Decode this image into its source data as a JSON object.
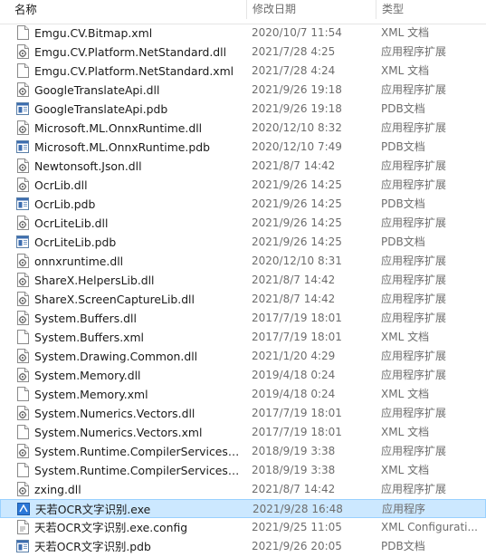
{
  "columns": {
    "name": "名称",
    "date": "修改日期",
    "type": "类型"
  },
  "files": [
    {
      "name": "Emgu.CV.Bitmap.xml",
      "date": "2020/10/7 11:54",
      "type": "XML 文档",
      "icon": "xml-icon"
    },
    {
      "name": "Emgu.CV.Platform.NetStandard.dll",
      "date": "2021/7/28 4:25",
      "type": "应用程序扩展",
      "icon": "dll-icon"
    },
    {
      "name": "Emgu.CV.Platform.NetStandard.xml",
      "date": "2021/7/28 4:24",
      "type": "XML 文档",
      "icon": "xml-icon"
    },
    {
      "name": "GoogleTranslateApi.dll",
      "date": "2021/9/26 19:18",
      "type": "应用程序扩展",
      "icon": "dll-icon"
    },
    {
      "name": "GoogleTranslateApi.pdb",
      "date": "2021/9/26 19:18",
      "type": "PDB文档",
      "icon": "pdb-icon"
    },
    {
      "name": "Microsoft.ML.OnnxRuntime.dll",
      "date": "2020/12/10 8:32",
      "type": "应用程序扩展",
      "icon": "dll-icon"
    },
    {
      "name": "Microsoft.ML.OnnxRuntime.pdb",
      "date": "2020/12/10 7:49",
      "type": "PDB文档",
      "icon": "pdb-icon"
    },
    {
      "name": "Newtonsoft.Json.dll",
      "date": "2021/8/7 14:42",
      "type": "应用程序扩展",
      "icon": "dll-icon"
    },
    {
      "name": "OcrLib.dll",
      "date": "2021/9/26 14:25",
      "type": "应用程序扩展",
      "icon": "dll-icon"
    },
    {
      "name": "OcrLib.pdb",
      "date": "2021/9/26 14:25",
      "type": "PDB文档",
      "icon": "pdb-icon"
    },
    {
      "name": "OcrLiteLib.dll",
      "date": "2021/9/26 14:25",
      "type": "应用程序扩展",
      "icon": "dll-icon"
    },
    {
      "name": "OcrLiteLib.pdb",
      "date": "2021/9/26 14:25",
      "type": "PDB文档",
      "icon": "pdb-icon"
    },
    {
      "name": "onnxruntime.dll",
      "date": "2020/12/10 8:31",
      "type": "应用程序扩展",
      "icon": "dll-icon"
    },
    {
      "name": "ShareX.HelpersLib.dll",
      "date": "2021/8/7 14:42",
      "type": "应用程序扩展",
      "icon": "dll-icon"
    },
    {
      "name": "ShareX.ScreenCaptureLib.dll",
      "date": "2021/8/7 14:42",
      "type": "应用程序扩展",
      "icon": "dll-icon"
    },
    {
      "name": "System.Buffers.dll",
      "date": "2017/7/19 18:01",
      "type": "应用程序扩展",
      "icon": "dll-icon"
    },
    {
      "name": "System.Buffers.xml",
      "date": "2017/7/19 18:01",
      "type": "XML 文档",
      "icon": "xml-icon"
    },
    {
      "name": "System.Drawing.Common.dll",
      "date": "2021/1/20 4:29",
      "type": "应用程序扩展",
      "icon": "dll-icon"
    },
    {
      "name": "System.Memory.dll",
      "date": "2019/4/18 0:24",
      "type": "应用程序扩展",
      "icon": "dll-icon"
    },
    {
      "name": "System.Memory.xml",
      "date": "2019/4/18 0:24",
      "type": "XML 文档",
      "icon": "xml-icon"
    },
    {
      "name": "System.Numerics.Vectors.dll",
      "date": "2017/7/19 18:01",
      "type": "应用程序扩展",
      "icon": "dll-icon"
    },
    {
      "name": "System.Numerics.Vectors.xml",
      "date": "2017/7/19 18:01",
      "type": "XML 文档",
      "icon": "xml-icon"
    },
    {
      "name": "System.Runtime.CompilerServices.Un...",
      "date": "2018/9/19 3:38",
      "type": "应用程序扩展",
      "icon": "dll-icon"
    },
    {
      "name": "System.Runtime.CompilerServices.Un...",
      "date": "2018/9/19 3:38",
      "type": "XML 文档",
      "icon": "xml-icon"
    },
    {
      "name": "zxing.dll",
      "date": "2021/8/7 14:42",
      "type": "应用程序扩展",
      "icon": "dll-icon"
    },
    {
      "name": "天若OCR文字识别.exe",
      "date": "2021/9/28 16:48",
      "type": "应用程序",
      "icon": "exe-icon",
      "selected": true
    },
    {
      "name": "天若OCR文字识别.exe.config",
      "date": "2021/9/25 11:05",
      "type": "XML Configurati...",
      "icon": "config-icon"
    },
    {
      "name": "天若OCR文字识别.pdb",
      "date": "2021/9/26 20:05",
      "type": "PDB文档",
      "icon": "pdb-icon"
    }
  ],
  "colors": {
    "selected_bg": "#cce8ff",
    "selected_border": "#99d1ff",
    "header_text": "#4c607a",
    "meta_text": "#6d6d6d"
  }
}
